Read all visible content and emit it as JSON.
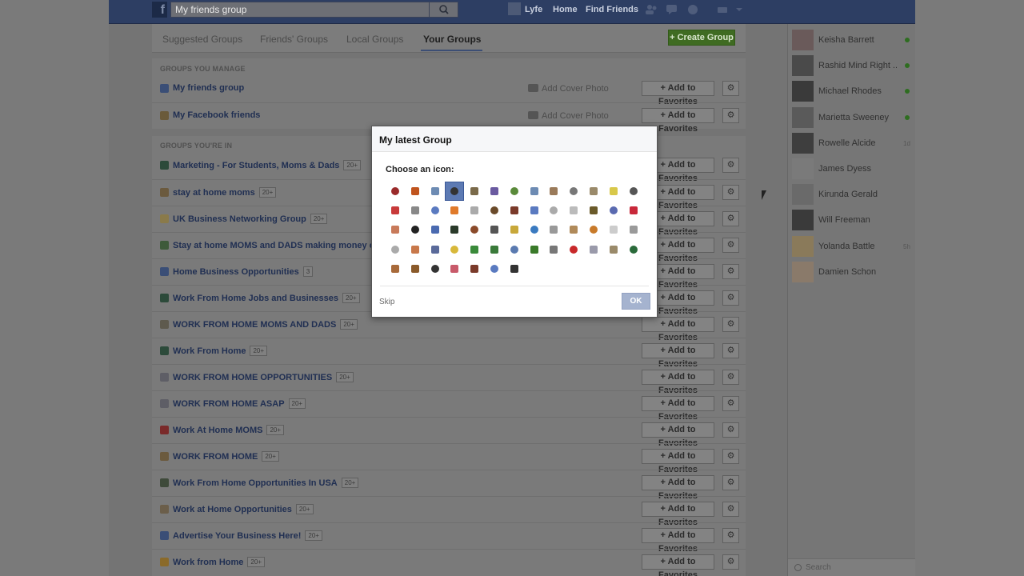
{
  "topbar": {
    "logo": "f",
    "search_value": "My friends group",
    "user_name": "Lyfe",
    "home": "Home",
    "find_friends": "Find Friends"
  },
  "tabs": [
    {
      "label": "Suggested Groups"
    },
    {
      "label": "Friends' Groups"
    },
    {
      "label": "Local Groups"
    },
    {
      "label": "Your Groups"
    }
  ],
  "create_group": "+ Create Group",
  "manage": {
    "header": "GROUPS YOU MANAGE",
    "groups": [
      {
        "name": "My friends group",
        "cover": "Add Cover Photo",
        "fav": "Add to Favorites"
      },
      {
        "name": "My Facebook friends",
        "cover": "Add Cover Photo",
        "fav": "Add to Favorites"
      }
    ]
  },
  "in": {
    "header": "GROUPS YOU'RE IN",
    "fav": "Add to Favorites",
    "groups": [
      {
        "name": "Marketing - For Students, Moms & Dads",
        "count": "20+",
        "color": "#2c4a3a"
      },
      {
        "name": "stay at home moms",
        "count": "20+",
        "color": "#6b5a3e"
      },
      {
        "name": "UK Business Networking Group",
        "count": "20+",
        "color": "#8a7a4a"
      },
      {
        "name": "Stay at home MOMS and DADS making money online",
        "count": "20+",
        "color": "#3e5a3a"
      },
      {
        "name": "Home Business Opportunities",
        "count": "3",
        "color": "#3a4e76"
      },
      {
        "name": "Work From Home Jobs and Businesses",
        "count": "20+",
        "color": "#2c4a3a"
      },
      {
        "name": "WORK FROM HOME MOMS AND DADS",
        "count": "20+",
        "color": "#5e5a4e"
      },
      {
        "name": "Work From Home",
        "count": "20+",
        "color": "#2c4a3a"
      },
      {
        "name": "WORK FROM HOME OPPORTUNITIES",
        "count": "20+",
        "color": "#5e5e66"
      },
      {
        "name": "WORK FROM HOME ASAP",
        "count": "20+",
        "color": "#5e5e66"
      },
      {
        "name": "Work At Home MOMS",
        "count": "20+",
        "color": "#7a2a2a"
      },
      {
        "name": "WORK FROM HOME",
        "count": "20+",
        "color": "#6b5a3e"
      },
      {
        "name": "Work From Home Opportunities In USA",
        "count": "20+",
        "color": "#3e4a3a"
      },
      {
        "name": "Work at Home Opportunities",
        "count": "20+",
        "color": "#6b5e4a"
      },
      {
        "name": "Advertise Your Business Here!",
        "count": "20+",
        "color": "#3a4e76"
      },
      {
        "name": "Work from Home",
        "count": "20+",
        "color": "#8a6a2a"
      }
    ]
  },
  "modal": {
    "title": "My latest Group",
    "choose": "Choose an icon:",
    "skip": "Skip",
    "ok": "OK",
    "selected_index": 3,
    "icon_colors": [
      "#9a2a2a",
      "#c0541e",
      "#6d8bb3",
      "#333333",
      "#7a6a4a",
      "#6a5aa0",
      "#5a8a3a",
      "#6d8bb3",
      "#9a7a5a",
      "#777777",
      "#9a8a6a",
      "#d8c84a",
      "#555555",
      "#c83a3a",
      "#888888",
      "#5a7ac0",
      "#e07a2a",
      "#aaaaaa",
      "#6a4a2a",
      "#7a3a2a",
      "#5a7ac0",
      "#aaaaaa",
      "#bbbbbb",
      "#6a5a2a",
      "#5a6ab0",
      "#c8283a",
      "#c87a5a",
      "#222222",
      "#4a6ab0",
      "#2a3a2a",
      "#8a4a2a",
      "#555555",
      "#c8a83a",
      "#3a7ac0",
      "#999999",
      "#b08a5a",
      "#c87a2a",
      "#cccccc",
      "#9a9a9a",
      "#aaaaaa",
      "#c8784a",
      "#5a6a9a",
      "#d8b83a",
      "#3a8a3a",
      "#3a7a3a",
      "#5a7ab0",
      "#3a7a2a",
      "#777777",
      "#c8282a",
      "#9a9aaa",
      "#9a8a6a",
      "#2a6a3a",
      "#a86a3a",
      "#8a5a2a",
      "#333333",
      "#c85a6a",
      "#7a3a2a",
      "#5a7ac0",
      "#333333"
    ]
  },
  "friends": [
    {
      "name": "Keisha Barrett",
      "status": "online",
      "color": "#6a5a5a"
    },
    {
      "name": "Rashid Mind Right ...",
      "status": "online",
      "color": "#4a4a4a"
    },
    {
      "name": "Michael Rhodes",
      "status": "online",
      "color": "#3a3a3a"
    },
    {
      "name": "Marietta Sweeney",
      "status": "online",
      "color": "#5a5a5a"
    },
    {
      "name": "Rowelle Alcide",
      "status": "1d",
      "color": "#3e3e3e"
    },
    {
      "name": "James Dyess",
      "status": "",
      "color": "#7a7a7a"
    },
    {
      "name": "Kirunda Gerald",
      "status": "",
      "color": "#6a6a6a"
    },
    {
      "name": "Will Freeman",
      "status": "",
      "color": "#3a3a3a"
    },
    {
      "name": "Yolanda Battle",
      "status": "5h",
      "color": "#8a7a5a"
    },
    {
      "name": "Damien Schon",
      "status": "",
      "color": "#8a7a6a"
    }
  ],
  "chat_search": "Search"
}
